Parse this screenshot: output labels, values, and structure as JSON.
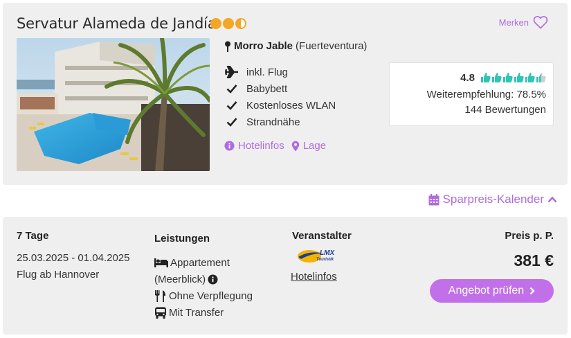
{
  "hotel": {
    "name": "Servatur Alameda de Jandía",
    "star_rating": 2.5,
    "save_label": "Merken",
    "location_city": "Morro Jable",
    "location_region": "(Fuerteventura)",
    "features": [
      {
        "icon": "plane-icon",
        "label": "inkl. Flug"
      },
      {
        "icon": "check-icon",
        "label": "Babybett"
      },
      {
        "icon": "check-icon",
        "label": "Kostenloses WLAN"
      },
      {
        "icon": "check-icon",
        "label": "Strandnähe"
      }
    ],
    "links": {
      "info": "Hotelinfos",
      "location": "Lage"
    }
  },
  "rating": {
    "score": "4.8",
    "thumbs_value": 5.5,
    "recommendation": "Weiterempfehlung: 78.5%",
    "reviews": "144 Bewertungen"
  },
  "calendar": {
    "label": "Sparpreis-Kalender"
  },
  "offer": {
    "duration": "7 Tage",
    "dates": "25.03.2025 - 01.04.2025",
    "flight": "Flug ab Hannover",
    "services_title": "Leistungen",
    "services": {
      "room": "Appartement",
      "room_detail": "(Meerblick)",
      "board": "Ohne Verpflegung",
      "transfer": "Mit Transfer"
    },
    "operator_title": "Veranstalter",
    "operator_logo_text": "LMX",
    "operator_logo_sub": "Touristik",
    "operator_link": "Hotelinfos",
    "price_label": "Preis p. P.",
    "price": "381 €",
    "cta": "Angebot prüfen"
  },
  "colors": {
    "accent": "#c170ea",
    "link": "#b06be0",
    "star": "#f5a623",
    "thumb": "#2ec4b6"
  }
}
